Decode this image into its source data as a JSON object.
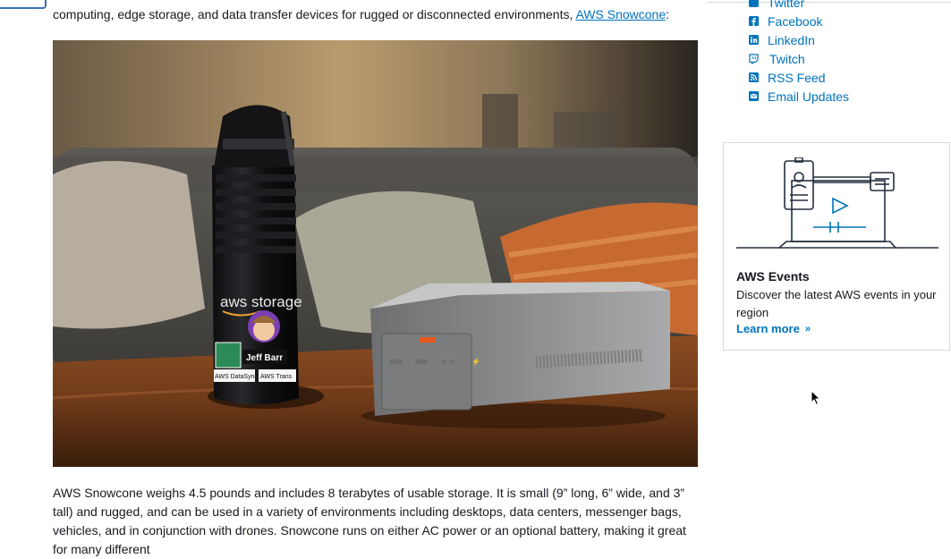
{
  "intro": {
    "text_before": "computing, edge storage, and data transfer devices for rugged or disconnected environments, ",
    "link": "AWS Snowcone",
    "text_after": ":"
  },
  "photo": {
    "bottle_brand": "aws storage",
    "bottle_name": "Jeff Barr",
    "sticker_left": "AWS DataSync",
    "sticker_right": "AWS Trans"
  },
  "body": {
    "paragraph": "AWS Snowcone weighs 4.5 pounds and includes 8 terabytes of usable storage. It is small (9” long, 6” wide, and 3” tall) and rugged, and can be used in a variety of environments including desktops, data centers, messenger bags, vehicles, and in conjunction with drones. Snowcone runs on either AC power or an optional battery, making it great for many different"
  },
  "sidebar": {
    "social": [
      {
        "label": "Twitter",
        "icon": "twitter-icon"
      },
      {
        "label": "Facebook",
        "icon": "facebook-icon"
      },
      {
        "label": "LinkedIn",
        "icon": "linkedin-icon"
      },
      {
        "label": "Twitch",
        "icon": "twitch-icon"
      },
      {
        "label": "RSS Feed",
        "icon": "rss-icon"
      },
      {
        "label": "Email Updates",
        "icon": "email-icon"
      }
    ],
    "events": {
      "title": "AWS Events",
      "description": "Discover the latest AWS events in your region",
      "link": "Learn more",
      "link_icon": "double-chevron-right-icon"
    }
  },
  "colors": {
    "link": "#0073bb",
    "text": "#16191f",
    "border": "#d5dbdb"
  }
}
